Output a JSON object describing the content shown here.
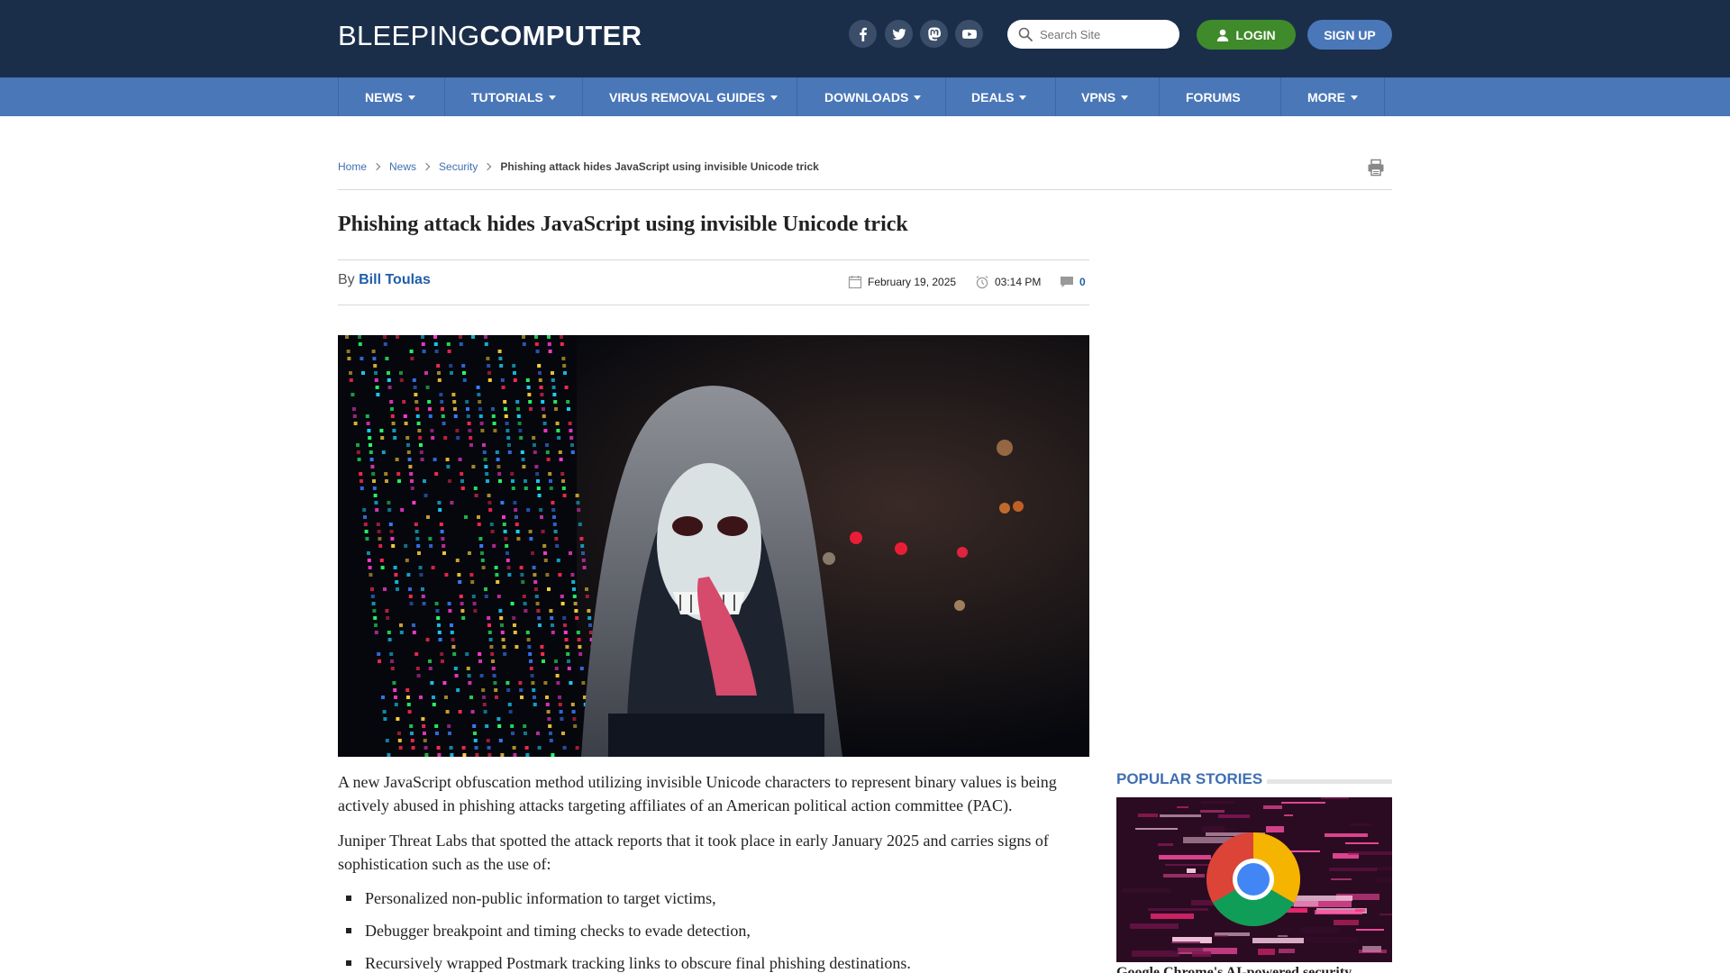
{
  "site": {
    "logo_light": "BLEEPING",
    "logo_bold": "COMPUTER"
  },
  "header": {
    "social": [
      "facebook-icon",
      "twitter-icon",
      "mastodon-icon",
      "youtube-icon"
    ],
    "search_placeholder": "Search Site",
    "login_label": "LOGIN",
    "signup_label": "SIGN UP"
  },
  "nav": {
    "items": [
      {
        "label": "NEWS",
        "dropdown": true
      },
      {
        "label": "TUTORIALS",
        "dropdown": true
      },
      {
        "label": "VIRUS REMOVAL GUIDES",
        "dropdown": true
      },
      {
        "label": "DOWNLOADS",
        "dropdown": true
      },
      {
        "label": "DEALS",
        "dropdown": true
      },
      {
        "label": "VPNS",
        "dropdown": true
      },
      {
        "label": "FORUMS",
        "dropdown": false
      },
      {
        "label": "MORE",
        "dropdown": true
      }
    ]
  },
  "breadcrumb": {
    "home": "Home",
    "news": "News",
    "security": "Security",
    "current": "Phishing attack hides JavaScript using invisible Unicode trick"
  },
  "article": {
    "title": "Phishing attack hides JavaScript using invisible Unicode trick",
    "by": "By ",
    "author": "Bill Toulas",
    "date": "February 19, 2025",
    "time": "03:14 PM",
    "comments": "0",
    "paragraphs": [
      "A new JavaScript obfuscation method utilizing invisible Unicode characters to represent binary values is being actively abused in phishing attacks targeting affiliates of an American political action committee (PAC).",
      "Juniper Threat Labs that spotted the attack reports that it took place in early January 2025 and carries signs of sophistication such as the use of:"
    ],
    "bullets": [
      "Personalized non-public information to target victims,",
      "Debugger breakpoint and timing checks to evade detection,",
      "Recursively wrapped Postmark tracking links to obscure final phishing destinations."
    ]
  },
  "sidebar": {
    "popular_title": "POPULAR STORIES",
    "story_caption": "Google Chrome's AI-powered security"
  },
  "colors": {
    "header_bg": "#1a2e4a",
    "nav_bg": "#4a77b8",
    "login_green": "#3f8a2a",
    "link_blue": "#1f5ea8"
  }
}
